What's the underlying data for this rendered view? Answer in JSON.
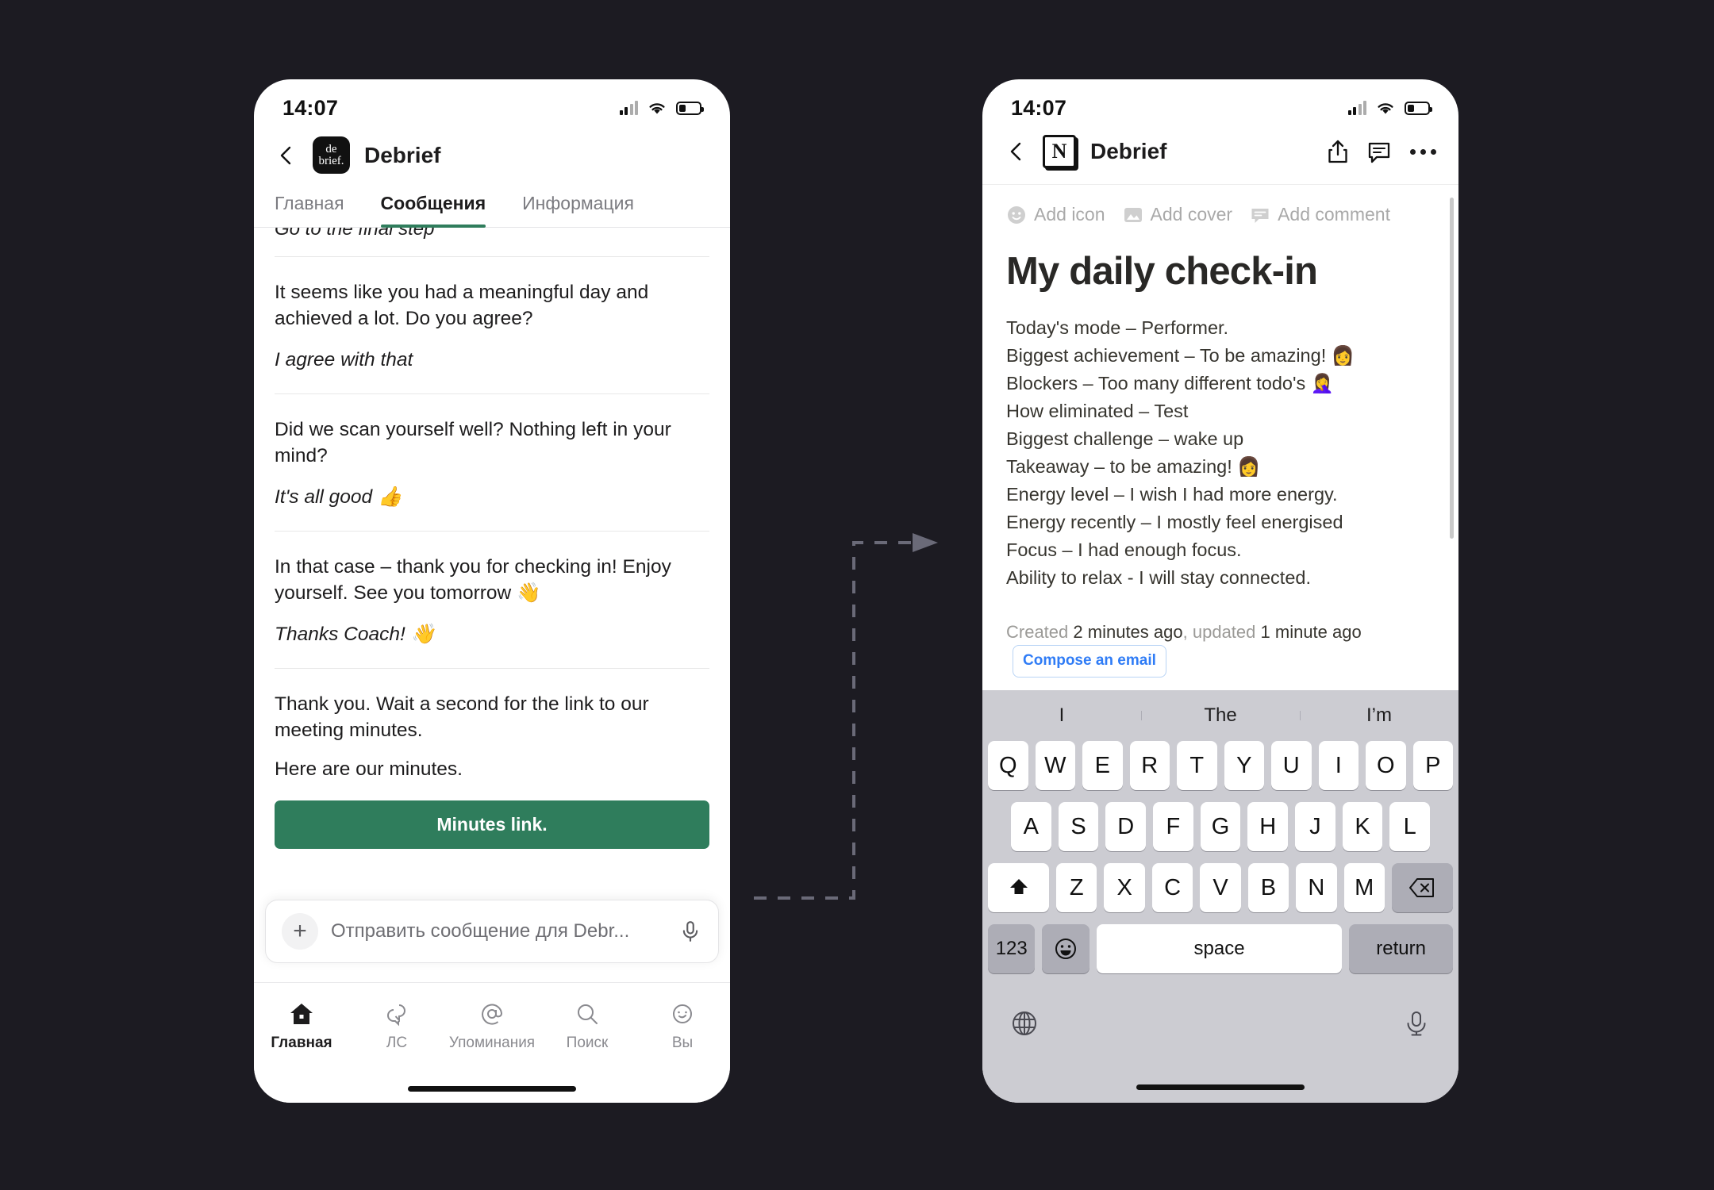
{
  "canvas": {
    "background": "#1c1b22"
  },
  "left_phone": {
    "status": {
      "time": "14:07"
    },
    "header": {
      "back_icon": "chevron-left-icon",
      "workspace_logo_line1": "de",
      "workspace_logo_line2": "brief.",
      "title": "Debrief"
    },
    "tabs": [
      {
        "label": "Главная",
        "active": false
      },
      {
        "label": "Сообщения",
        "active": true
      },
      {
        "label": "Информация",
        "active": false
      }
    ],
    "clipped_message": "Go to the final step",
    "messages": [
      {
        "bot": "It seems like you had a meaningful day and achieved a lot. Do you agree?",
        "user": "I agree with that"
      },
      {
        "bot": "Did we scan yourself well? Nothing left in your mind?",
        "user": "It's all good 👍"
      },
      {
        "bot": "In that case – thank you for checking in! Enjoy yourself. See you tomorrow 👋",
        "user": "Thanks Coach! 👋"
      }
    ],
    "final_group": {
      "bot": "Thank you. Wait a second for the link to our meeting minutes.",
      "sub": "Here are our minutes.",
      "button_label": "Minutes link.",
      "button_color": "#2f7d5c"
    },
    "composer": {
      "plus_label": "+",
      "placeholder": "Отправить сообщение для Debr...",
      "mic_icon": "microphone-icon"
    },
    "tabbar": [
      {
        "label": "Главная",
        "icon": "home-icon",
        "active": true
      },
      {
        "label": "ЛС",
        "icon": "dm-bubbles-icon",
        "active": false
      },
      {
        "label": "Упоминания",
        "icon": "at-mention-icon",
        "active": false
      },
      {
        "label": "Поиск",
        "icon": "search-icon",
        "active": false
      },
      {
        "label": "Вы",
        "icon": "you-face-icon",
        "active": false
      }
    ]
  },
  "right_phone": {
    "status": {
      "time": "14:07"
    },
    "header": {
      "back_icon": "chevron-left-icon",
      "app_logo": "N",
      "title": "Debrief",
      "share_icon": "share-icon",
      "comment_icon": "comment-icon",
      "more_icon": "more-dots-icon"
    },
    "doc_actions": [
      {
        "label": "Add icon",
        "icon": "smiley-icon"
      },
      {
        "label": "Add cover",
        "icon": "image-icon"
      },
      {
        "label": "Add comment",
        "icon": "comment-icon"
      }
    ],
    "document": {
      "title": "My daily check-in",
      "lines": [
        "Today's mode – Performer.",
        "Biggest achievement – To be amazing! 👩",
        "Blockers – Too many different todo's 🤦‍♀️",
        "How eliminated – Test",
        "Biggest challenge – wake up",
        "Takeaway – to be amazing! 👩",
        "Energy level – I wish I had more energy.",
        "Energy recently – I mostly feel energised",
        "Focus – I had enough focus.",
        "Ability to relax - I will stay connected."
      ],
      "meta_created_label": "Created",
      "meta_created_value": "2 minutes ago",
      "meta_sep": ",",
      "meta_updated_label": "updated",
      "meta_updated_value": "1 minute ago",
      "email_chip": "Compose an email",
      "email_chip_color": "#2f7cf6"
    },
    "keyboard": {
      "predictions": [
        "I",
        "The",
        "I’m"
      ],
      "row1": [
        "Q",
        "W",
        "E",
        "R",
        "T",
        "Y",
        "U",
        "I",
        "O",
        "P"
      ],
      "row2": [
        "A",
        "S",
        "D",
        "F",
        "G",
        "H",
        "J",
        "K",
        "L"
      ],
      "row3": [
        "Z",
        "X",
        "C",
        "V",
        "B",
        "N",
        "M"
      ],
      "shift_icon": "shift-up-icon",
      "backspace_icon": "backspace-icon",
      "numeric_label": "123",
      "emoji_icon": "emoji-smiley-icon",
      "space_label": "space",
      "return_label": "return",
      "globe_icon": "globe-icon",
      "dictation_icon": "microphone-icon"
    }
  },
  "connector": {
    "type": "dashed-arrow",
    "color": "#6a6a78"
  }
}
